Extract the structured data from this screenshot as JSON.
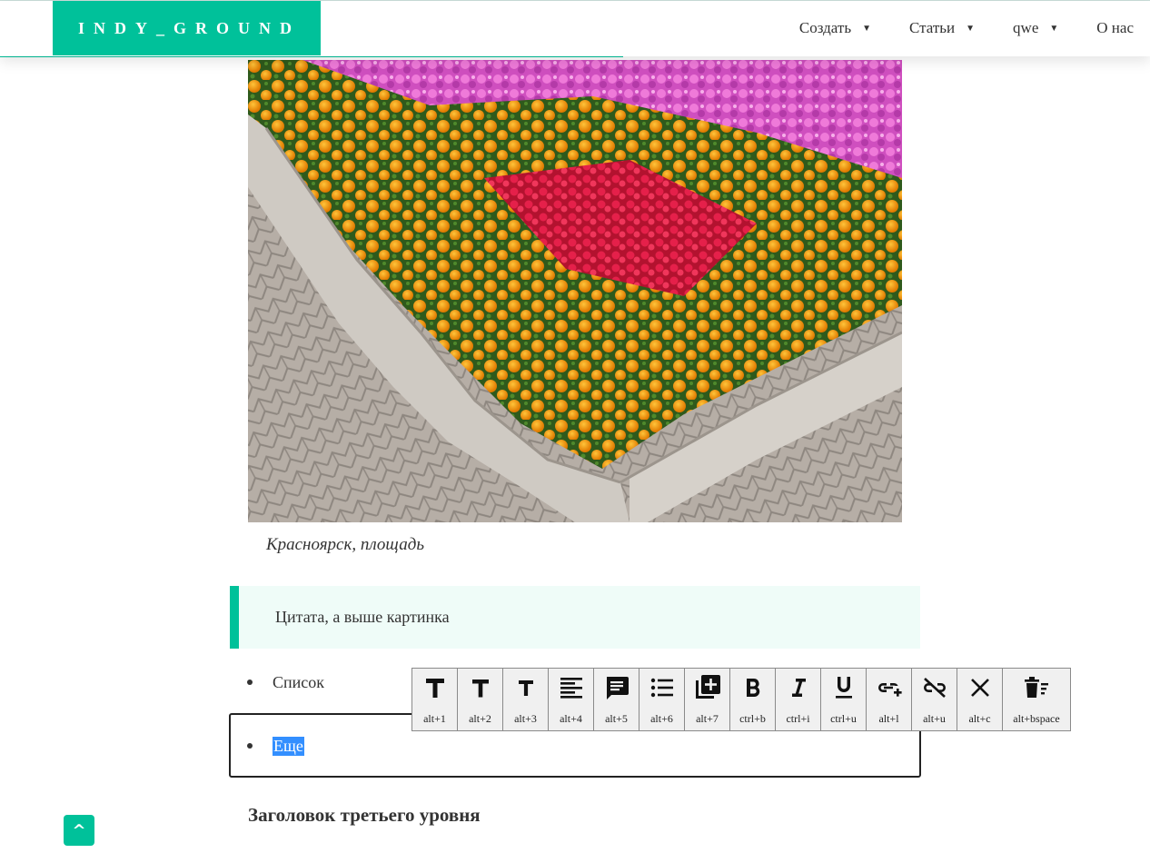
{
  "header": {
    "logo": "INDY_GROUND",
    "nav": [
      {
        "label": "Создать",
        "dropdown": true
      },
      {
        "label": "Статьи",
        "dropdown": true
      },
      {
        "label": "qwe",
        "dropdown": true
      },
      {
        "label": "О нас",
        "dropdown": false
      }
    ],
    "reading_progress_fraction": 0.54
  },
  "article": {
    "image_caption": "Красноярск, площадь",
    "quote": "Цитата, а выше картинка",
    "list": [
      "Список",
      "Еще"
    ],
    "heading3": "Заголовок третьего уровня"
  },
  "toolbar": [
    {
      "icon": "heading-1-icon",
      "shortcut": "alt+1"
    },
    {
      "icon": "heading-2-icon",
      "shortcut": "alt+2"
    },
    {
      "icon": "heading-3-icon",
      "shortcut": "alt+3"
    },
    {
      "icon": "paragraph-icon",
      "shortcut": "alt+4"
    },
    {
      "icon": "quote-icon",
      "shortcut": "alt+5"
    },
    {
      "icon": "list-icon",
      "shortcut": "alt+6"
    },
    {
      "icon": "insert-block-icon",
      "shortcut": "alt+7"
    },
    {
      "icon": "bold-icon",
      "shortcut": "ctrl+b"
    },
    {
      "icon": "italic-icon",
      "shortcut": "ctrl+i"
    },
    {
      "icon": "underline-icon",
      "shortcut": "ctrl+u"
    },
    {
      "icon": "link-icon",
      "shortcut": "alt+l"
    },
    {
      "icon": "unlink-icon",
      "shortcut": "alt+u"
    },
    {
      "icon": "clear-icon",
      "shortcut": "alt+c"
    },
    {
      "icon": "delete-block-icon",
      "shortcut": "alt+bspace"
    }
  ],
  "scroll_top_label": "^",
  "colors": {
    "accent": "#00c19a",
    "quote_bg": "#effcf8",
    "selection": "#338fff"
  }
}
